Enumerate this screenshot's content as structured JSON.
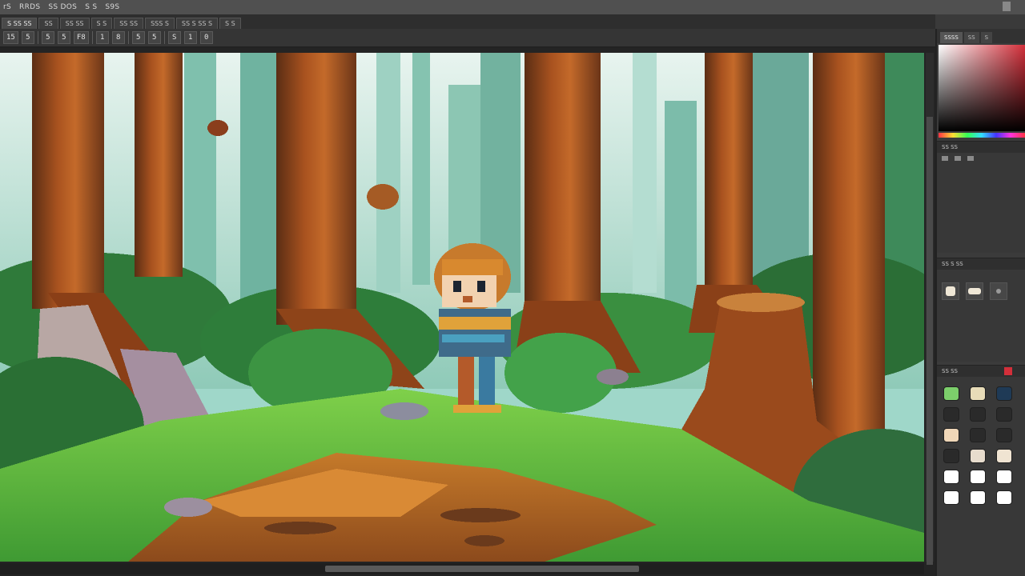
{
  "menu": {
    "items": [
      "rS",
      "RRDS",
      "SS DOS",
      "S S",
      "S9S"
    ]
  },
  "tabs": [
    "S  SS  SS",
    "SS",
    "SS SS",
    "S  S",
    "SS  SS",
    "SSS  S",
    "SS  S SS  S",
    "S  S"
  ],
  "toolbar": {
    "buttons": [
      "15",
      "5",
      "5",
      "5",
      "F8",
      "1",
      "8",
      "5",
      "5",
      "S",
      "1",
      "0"
    ]
  },
  "panel": {
    "tabs": [
      "SSSS",
      "SS",
      "S"
    ],
    "sections": [
      {
        "title": "SS   SS"
      },
      {
        "title": "SS   S  SS"
      },
      {
        "title": "SS  SS"
      }
    ]
  },
  "colors": {
    "accent": "#d32f3a",
    "swatches": [
      "#7ccf6b",
      "#e8dcb8",
      "#1f3a56",
      "#2a2a2a",
      "#2a2a2a",
      "#2a2a2a",
      "#f0d7b8",
      "#2a2a2a",
      "#2a2a2a",
      "#2a2a2a",
      "#e7dccd",
      "#f0e4d2",
      "#ffffff",
      "#ffffff",
      "#ffffff",
      "#ffffff",
      "#ffffff",
      "#ffffff"
    ]
  }
}
